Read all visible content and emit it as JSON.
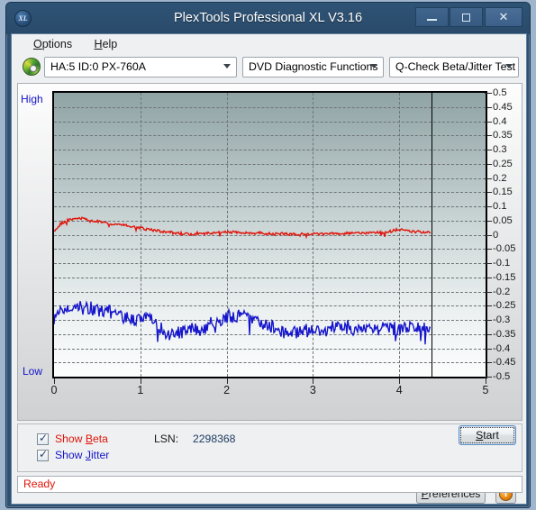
{
  "window": {
    "title": "PlexTools Professional XL V3.16",
    "app_icon": "XL",
    "minimize_label": "minimize",
    "maximize_label": "maximize",
    "close_label": "✕"
  },
  "menubar": {
    "items": [
      {
        "label": "Options",
        "accel": "O"
      },
      {
        "label": "Help",
        "accel": "H"
      }
    ]
  },
  "toolbar": {
    "drive": "HA:5 ID:0  PX-760A",
    "functions": "DVD Diagnostic Functions",
    "test": "Q-Check Beta/Jitter Test"
  },
  "options": {
    "show_beta": "Show Beta",
    "show_jitter": "Show Jitter",
    "show_beta_checked": true,
    "show_jitter_checked": true,
    "lsn_label": "LSN:",
    "lsn_value": "2298368"
  },
  "buttons": {
    "start": "Start",
    "preferences": "Preferences",
    "info": "i"
  },
  "status": {
    "text": "Ready"
  },
  "chart_data": {
    "type": "line",
    "title": "Q-Check Beta/Jitter Test",
    "xlabel": "",
    "ylabel": "",
    "xlim": [
      0,
      5
    ],
    "ylim": [
      -0.5,
      0.5
    ],
    "grid": true,
    "legend_position": "below-left",
    "axis_left_label_top": "High",
    "axis_left_label_bottom": "Low",
    "x_ticks": [
      0,
      1,
      2,
      3,
      4,
      5
    ],
    "y_ticks": [
      0.5,
      0.45,
      0.4,
      0.35,
      0.3,
      0.25,
      0.2,
      0.15,
      0.1,
      0.05,
      0,
      -0.05,
      -0.1,
      -0.15,
      -0.2,
      -0.25,
      -0.3,
      -0.35,
      -0.4,
      -0.45,
      -0.5
    ],
    "data_end_x": 4.37,
    "colors": {
      "beta": "#e1140a",
      "jitter": "#1515cc"
    },
    "series": [
      {
        "name": "Beta",
        "color": "#e1140a",
        "x": [
          0.0,
          0.05,
          0.1,
          0.15,
          0.2,
          0.25,
          0.3,
          0.35,
          0.4,
          0.45,
          0.5,
          0.55,
          0.6,
          0.65,
          0.7,
          0.75,
          0.8,
          0.85,
          0.9,
          0.95,
          1.0,
          1.05,
          1.1,
          1.15,
          1.2,
          1.25,
          1.3,
          1.35,
          1.4,
          1.45,
          1.5,
          1.55,
          1.6,
          1.65,
          1.7,
          1.75,
          1.8,
          1.85,
          1.9,
          1.95,
          2.0,
          2.05,
          2.1,
          2.15,
          2.2,
          2.25,
          2.3,
          2.35,
          2.4,
          2.45,
          2.5,
          2.55,
          2.6,
          2.65,
          2.7,
          2.75,
          2.8,
          2.85,
          2.9,
          2.95,
          3.0,
          3.05,
          3.1,
          3.15,
          3.2,
          3.25,
          3.3,
          3.35,
          3.4,
          3.45,
          3.5,
          3.55,
          3.6,
          3.65,
          3.7,
          3.75,
          3.8,
          3.85,
          3.9,
          3.95,
          4.0,
          4.05,
          4.1,
          4.15,
          4.2,
          4.25,
          4.3,
          4.37
        ],
        "y": [
          0.01,
          0.03,
          0.042,
          0.05,
          0.055,
          0.058,
          0.06,
          0.057,
          0.053,
          0.05,
          0.047,
          0.044,
          0.041,
          0.039,
          0.038,
          0.036,
          0.034,
          0.031,
          0.029,
          0.026,
          0.024,
          0.021,
          0.018,
          0.016,
          0.014,
          0.012,
          0.01,
          0.008,
          0.006,
          0.005,
          0.004,
          0.003,
          0.003,
          0.004,
          0.004,
          0.005,
          0.006,
          0.007,
          0.008,
          0.009,
          0.009,
          0.009,
          0.008,
          0.008,
          0.007,
          0.007,
          0.006,
          0.005,
          0.005,
          0.004,
          0.004,
          0.003,
          0.003,
          0.003,
          0.002,
          0.002,
          0.002,
          0.002,
          0.002,
          0.002,
          0.003,
          0.003,
          0.003,
          0.003,
          0.004,
          0.004,
          0.004,
          0.005,
          0.005,
          0.006,
          0.006,
          0.007,
          0.007,
          0.008,
          0.008,
          0.009,
          0.009,
          0.01,
          0.01,
          0.015,
          0.017,
          0.016,
          0.014,
          0.012,
          0.011,
          0.01,
          0.009,
          0.006
        ]
      },
      {
        "name": "Jitter",
        "color": "#1515cc",
        "x": [
          0.0,
          0.05,
          0.1,
          0.15,
          0.2,
          0.25,
          0.3,
          0.35,
          0.4,
          0.45,
          0.5,
          0.55,
          0.6,
          0.65,
          0.7,
          0.75,
          0.8,
          0.85,
          0.9,
          0.95,
          1.0,
          1.05,
          1.1,
          1.15,
          1.2,
          1.25,
          1.3,
          1.35,
          1.4,
          1.45,
          1.5,
          1.55,
          1.6,
          1.65,
          1.7,
          1.75,
          1.8,
          1.85,
          1.9,
          1.95,
          2.0,
          2.05,
          2.1,
          2.15,
          2.2,
          2.25,
          2.3,
          2.35,
          2.4,
          2.45,
          2.5,
          2.55,
          2.6,
          2.65,
          2.7,
          2.75,
          2.8,
          2.85,
          2.9,
          2.95,
          3.0,
          3.05,
          3.1,
          3.15,
          3.2,
          3.25,
          3.3,
          3.35,
          3.4,
          3.45,
          3.5,
          3.55,
          3.6,
          3.65,
          3.7,
          3.75,
          3.8,
          3.85,
          3.9,
          3.95,
          4.0,
          4.05,
          4.1,
          4.15,
          4.2,
          4.25,
          4.3,
          4.37
        ],
        "y": [
          -0.3,
          -0.282,
          -0.268,
          -0.262,
          -0.258,
          -0.252,
          -0.25,
          -0.258,
          -0.262,
          -0.264,
          -0.266,
          -0.268,
          -0.27,
          -0.272,
          -0.274,
          -0.278,
          -0.284,
          -0.292,
          -0.298,
          -0.3,
          -0.296,
          -0.292,
          -0.296,
          -0.304,
          -0.318,
          -0.332,
          -0.344,
          -0.35,
          -0.352,
          -0.348,
          -0.342,
          -0.336,
          -0.33,
          -0.334,
          -0.34,
          -0.33,
          -0.318,
          -0.308,
          -0.3,
          -0.296,
          -0.294,
          -0.29,
          -0.288,
          -0.286,
          -0.284,
          -0.286,
          -0.292,
          -0.3,
          -0.308,
          -0.316,
          -0.324,
          -0.33,
          -0.334,
          -0.336,
          -0.338,
          -0.34,
          -0.342,
          -0.34,
          -0.338,
          -0.336,
          -0.338,
          -0.34,
          -0.338,
          -0.334,
          -0.33,
          -0.326,
          -0.324,
          -0.322,
          -0.324,
          -0.328,
          -0.33,
          -0.328,
          -0.326,
          -0.328,
          -0.332,
          -0.334,
          -0.332,
          -0.33,
          -0.328,
          -0.33,
          -0.332,
          -0.33,
          -0.328,
          -0.33,
          -0.332,
          -0.33,
          -0.328,
          -0.33
        ],
        "noise_amplitude": 0.022
      }
    ]
  }
}
